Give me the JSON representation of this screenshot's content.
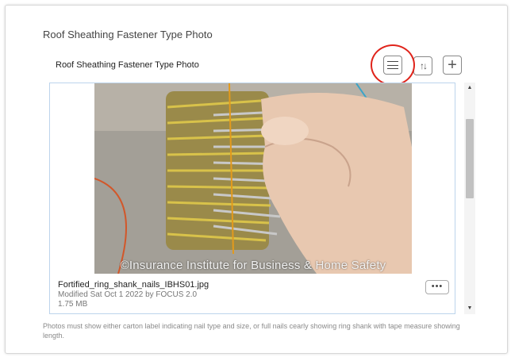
{
  "card": {
    "title": "Roof Sheathing Fastener Type Photo",
    "section_title": "Roof Sheathing Fastener Type Photo"
  },
  "toolbar": {
    "menu_icon": "hamburger-icon",
    "sort_icon": "sort-arrows-icon",
    "sort_label": "↑↓",
    "add_icon": "plus-icon",
    "add_label": "+"
  },
  "photo": {
    "watermark": "©Insurance Institute for Business & Home Safety"
  },
  "file": {
    "name": "Fortified_ring_shank_nails_IBHS01.jpg",
    "modified": "Modified Sat Oct 1 2022 by FOCUS 2.0",
    "size": "1.75 MB",
    "more_label": "•••"
  },
  "hint_text": "Photos must show either carton label indicating nail type and size, or full nails cearly showing ring shank with tape measure showing length.",
  "colors": {
    "highlight": "#e0241b",
    "viewer_border": "#bcd4ec"
  }
}
